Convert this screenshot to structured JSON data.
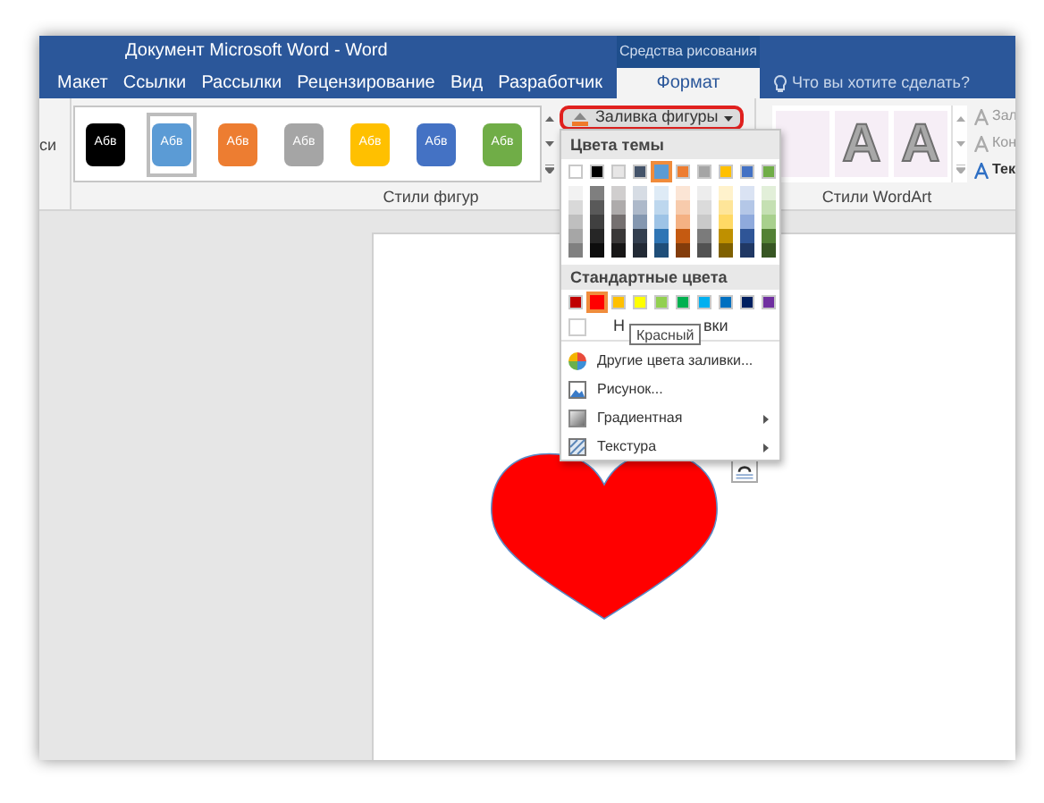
{
  "window": {
    "title": "Документ Microsoft Word - Word",
    "context_group": "Средства рисования"
  },
  "tabs": [
    {
      "label": "Макет",
      "selected": false
    },
    {
      "label": "Ссылки",
      "selected": false
    },
    {
      "label": "Рассылки",
      "selected": false
    },
    {
      "label": "Рецензирование",
      "selected": false
    },
    {
      "label": "Вид",
      "selected": false
    },
    {
      "label": "Разработчик",
      "selected": false
    },
    {
      "label": "Формат",
      "selected": true
    }
  ],
  "tell_me": {
    "placeholder": "Что вы хотите сделать?"
  },
  "ribbon": {
    "cut_label": "си",
    "shape_styles": {
      "group_label": "Стили фигур",
      "items": [
        {
          "label": "Абв",
          "color": "#000000",
          "selected": false
        },
        {
          "label": "Абв",
          "color": "#5b9bd5",
          "selected": true
        },
        {
          "label": "Абв",
          "color": "#ed7d31",
          "selected": false
        },
        {
          "label": "Абв",
          "color": "#a5a5a5",
          "selected": false
        },
        {
          "label": "Абв",
          "color": "#ffc000",
          "selected": false
        },
        {
          "label": "Абв",
          "color": "#4472c4",
          "selected": false
        },
        {
          "label": "Абв",
          "color": "#70ad47",
          "selected": false
        }
      ]
    },
    "shape_fill_button": {
      "label": "Заливка фигуры",
      "highlighted": true
    },
    "wordart": {
      "group_label": "Стили WordArt",
      "samples": [
        "A",
        "A"
      ],
      "commands": [
        "Зал",
        "Кон",
        "Тек"
      ]
    }
  },
  "fill_menu": {
    "theme_header": "Цвета темы",
    "theme_colors": [
      {
        "color": "#ffffff",
        "selected": false
      },
      {
        "color": "#000000",
        "selected": false
      },
      {
        "color": "#e7e6e6",
        "selected": false
      },
      {
        "color": "#44546a",
        "selected": false
      },
      {
        "color": "#5b9bd5",
        "selected": true
      },
      {
        "color": "#ed7d31",
        "selected": false
      },
      {
        "color": "#a5a5a5",
        "selected": false
      },
      {
        "color": "#ffc000",
        "selected": false
      },
      {
        "color": "#4472c4",
        "selected": false
      },
      {
        "color": "#70ad47",
        "selected": false
      }
    ],
    "theme_shades": [
      {
        "swatches": [
          {
            "color": "#f2f2f2"
          },
          {
            "color": "#7f7f7f"
          },
          {
            "color": "#d0cece"
          },
          {
            "color": "#d6dce4"
          },
          {
            "color": "#deebf6"
          },
          {
            "color": "#fbe5d5"
          },
          {
            "color": "#ededed"
          },
          {
            "color": "#fff2cc"
          },
          {
            "color": "#dae3f3"
          },
          {
            "color": "#e2efd9"
          }
        ]
      },
      {
        "swatches": [
          {
            "color": "#d9d9d9"
          },
          {
            "color": "#595959"
          },
          {
            "color": "#aeabab"
          },
          {
            "color": "#adb9ca"
          },
          {
            "color": "#bdd7ee"
          },
          {
            "color": "#f7cbac"
          },
          {
            "color": "#dbdbdb"
          },
          {
            "color": "#fee599"
          },
          {
            "color": "#b4c7e7"
          },
          {
            "color": "#c5e0b3"
          }
        ]
      },
      {
        "swatches": [
          {
            "color": "#bfbfbf"
          },
          {
            "color": "#404040"
          },
          {
            "color": "#757070"
          },
          {
            "color": "#8497b0"
          },
          {
            "color": "#9dc3e6"
          },
          {
            "color": "#f4b183"
          },
          {
            "color": "#c9c9c9"
          },
          {
            "color": "#ffd965"
          },
          {
            "color": "#8faadc"
          },
          {
            "color": "#a8d08d"
          }
        ]
      },
      {
        "swatches": [
          {
            "color": "#a6a6a6"
          },
          {
            "color": "#262626"
          },
          {
            "color": "#3a3838"
          },
          {
            "color": "#333f4f"
          },
          {
            "color": "#2e75b5"
          },
          {
            "color": "#c55a11"
          },
          {
            "color": "#7b7b7b"
          },
          {
            "color": "#bf9000"
          },
          {
            "color": "#2f5597"
          },
          {
            "color": "#538135"
          }
        ]
      },
      {
        "swatches": [
          {
            "color": "#808080"
          },
          {
            "color": "#0d0d0d"
          },
          {
            "color": "#171616"
          },
          {
            "color": "#222a35"
          },
          {
            "color": "#1f4e79"
          },
          {
            "color": "#833c0b"
          },
          {
            "color": "#525252"
          },
          {
            "color": "#7f6000"
          },
          {
            "color": "#203864"
          },
          {
            "color": "#375623"
          }
        ]
      }
    ],
    "standard_header": "Стандартные цвета",
    "standard_colors": [
      {
        "color": "#c00000",
        "selected": false
      },
      {
        "color": "#ff0000",
        "selected": true
      },
      {
        "color": "#ffc000",
        "selected": false
      },
      {
        "color": "#ffff00",
        "selected": false
      },
      {
        "color": "#92d050",
        "selected": false
      },
      {
        "color": "#00b050",
        "selected": false
      },
      {
        "color": "#00b0f0",
        "selected": false
      },
      {
        "color": "#0070c0",
        "selected": false
      },
      {
        "color": "#002060",
        "selected": false
      },
      {
        "color": "#7030a0",
        "selected": false
      }
    ],
    "no_fill": {
      "visible_start": "Н",
      "visible_end": "вки"
    },
    "tooltip": "Красный",
    "items": [
      {
        "kind": "more_colors",
        "label": "Другие цвета заливки...",
        "submenu": false
      },
      {
        "kind": "picture",
        "label": "Рисунок...",
        "submenu": false
      },
      {
        "kind": "gradient",
        "label": "Градиентная",
        "submenu": true
      },
      {
        "kind": "texture",
        "label": "Текстура",
        "submenu": true
      }
    ]
  }
}
